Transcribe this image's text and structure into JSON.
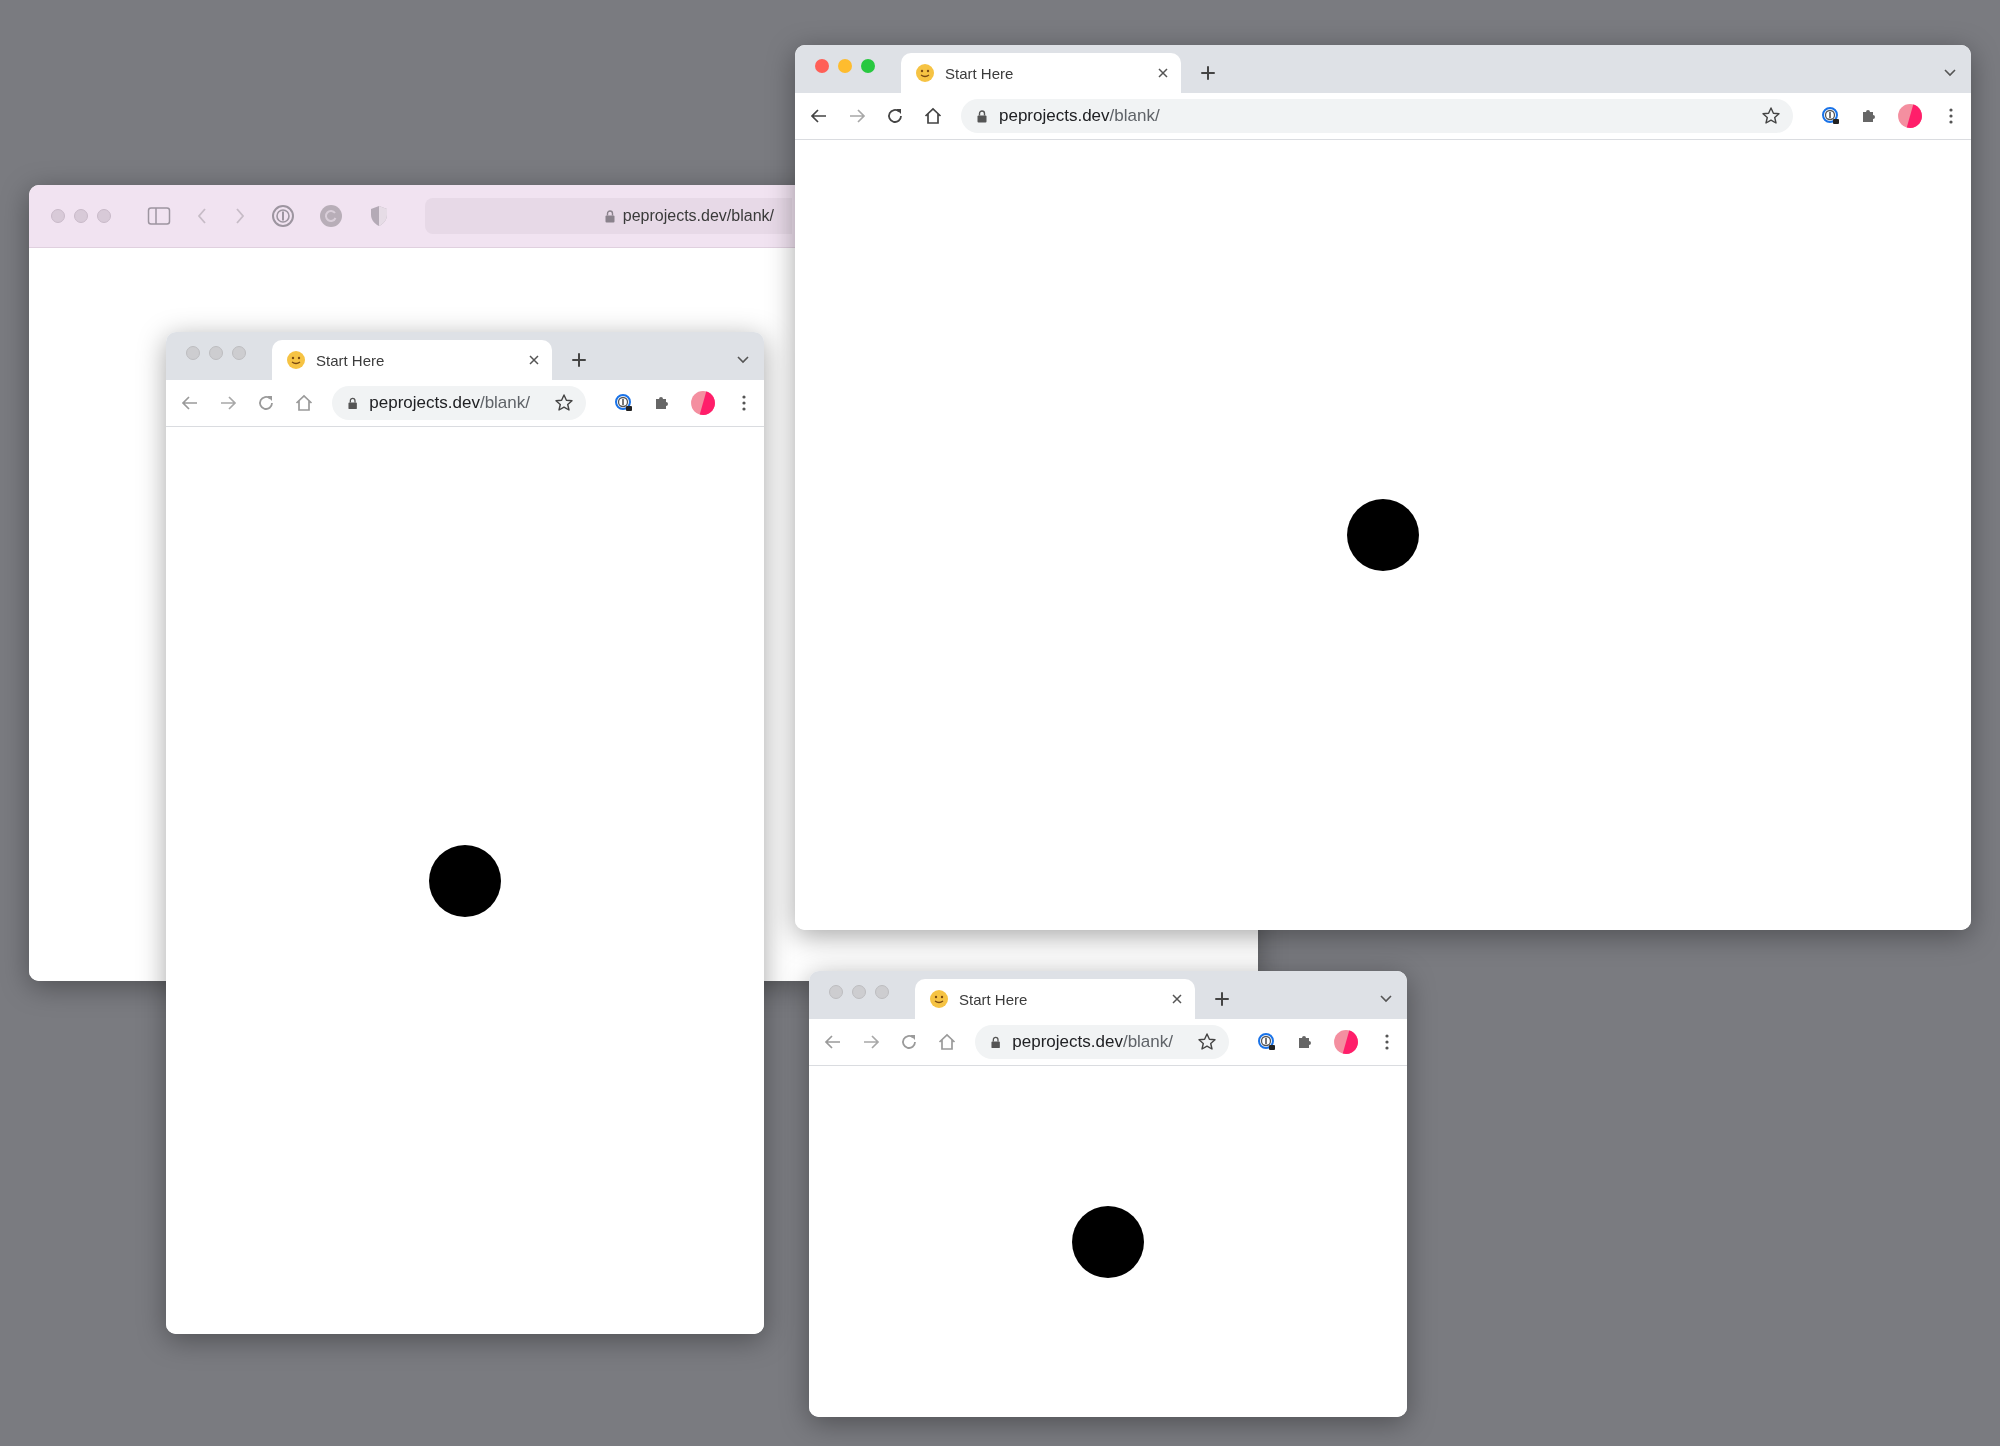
{
  "windows": [
    {
      "kind": "safari",
      "focused": false,
      "url": "peprojects.dev/blank/"
    },
    {
      "kind": "chrome",
      "focused": false,
      "tab": {
        "title": "Start Here",
        "selected": true
      },
      "url": {
        "host": "peprojects.dev",
        "path": "/blank/"
      }
    },
    {
      "kind": "chrome",
      "focused": true,
      "tab": {
        "title": "Start Here",
        "selected": true
      },
      "url": {
        "host": "peprojects.dev",
        "path": "/blank/"
      }
    },
    {
      "kind": "chrome",
      "focused": false,
      "tab": {
        "title": "Start Here",
        "selected": true
      },
      "url": {
        "host": "peprojects.dev",
        "path": "/blank/"
      }
    }
  ]
}
